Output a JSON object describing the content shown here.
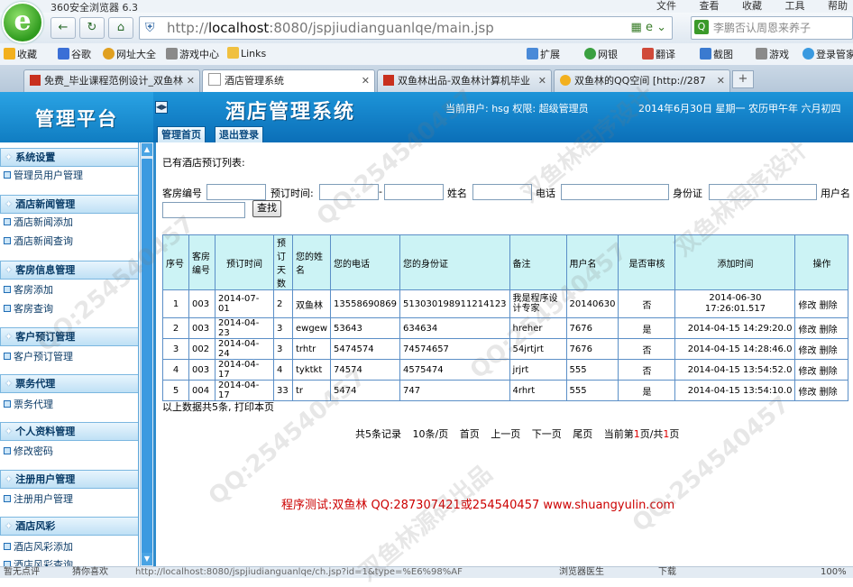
{
  "browser": {
    "title": "360安全浏览器 6.3",
    "menu": [
      "文件",
      "查看",
      "收藏",
      "工具",
      "帮助"
    ],
    "address_host": "localhost",
    "address_rest": ":8080/jspjiudianguanlqe/main.jsp",
    "address_prefix": "http://",
    "search_placeholder": "李鹏否认周恩来养子",
    "bookmarks": {
      "left": [
        "收藏",
        "谷歌",
        "网址大全",
        "游戏中心",
        "Links"
      ],
      "right": [
        "扩展",
        "网银",
        "翻译",
        "截图",
        "游戏",
        "登录管家"
      ]
    },
    "tabs": [
      "免费_毕业课程范例设计_双鱼林",
      "酒店管理系统",
      "双鱼林出品-双鱼林计算机毕业",
      "双鱼林的QQ空间 [http://287"
    ],
    "status": {
      "left": "暂无点评",
      "mid": "猜你喜欢",
      "url": "http://localhost:8080/jspjiudianguanlqe/ch.jsp?id=1&type=%E6%98%AF",
      "browser_doctor": "浏览器医生",
      "download": "下载",
      "zoom": "100%"
    }
  },
  "app": {
    "platform_title": "管理平台",
    "system_title": "酒店管理系统",
    "user_info": "当前用户: hsg 权限: 超级管理员",
    "date_info": "2014年6月30日 星期一 农历甲午年 六月初四",
    "header_tabs": [
      "管理首页",
      "退出登录"
    ]
  },
  "sidebar": [
    {
      "title": "系统设置",
      "items": [
        "管理员用户管理"
      ]
    },
    {
      "title": "酒店新闻管理",
      "items": [
        "酒店新闻添加",
        "酒店新闻查询"
      ]
    },
    {
      "title": "客房信息管理",
      "items": [
        "客房添加",
        "客房查询"
      ]
    },
    {
      "title": "客户预订管理",
      "items": [
        "客户预订管理"
      ]
    },
    {
      "title": "票务代理",
      "items": [
        "票务代理"
      ]
    },
    {
      "title": "个人资料管理",
      "items": [
        "修改密码"
      ]
    },
    {
      "title": "注册用户管理",
      "items": [
        "注册用户管理"
      ]
    },
    {
      "title": "酒店风彩",
      "items": [
        "酒店风彩添加",
        "酒店风彩查询"
      ]
    }
  ],
  "main": {
    "list_title": "已有酒店预订列表:",
    "filters": {
      "room_no": "客房编号",
      "order_time": "预订时间:",
      "range_sep": "-",
      "name": "姓名",
      "phone": "电话",
      "id_card": "身份证",
      "user_name": "用户名",
      "search_button": "查找"
    },
    "table": {
      "headers": [
        "序号",
        "客房编号",
        "预订时间",
        "预订天数",
        "您的姓名",
        "您的电话",
        "您的身份证",
        "备注",
        "用户名",
        "是否审核",
        "添加时间",
        "操作"
      ],
      "rows": [
        [
          "1",
          "003",
          "2014-07-01",
          "2",
          "双鱼林",
          "13558690869",
          "513030198911214123",
          "我是程序设计专家",
          "20140630",
          "否",
          "2014-06-30 17:26:01.517"
        ],
        [
          "2",
          "003",
          "2014-04-23",
          "3",
          "ewgew",
          "53643",
          "634634",
          "hreher",
          "7676",
          "是",
          "2014-04-15 14:29:20.0"
        ],
        [
          "3",
          "002",
          "2014-04-24",
          "3",
          "trhtr",
          "5474574",
          "74574657",
          "54jrtjrt",
          "7676",
          "否",
          "2014-04-15 14:28:46.0"
        ],
        [
          "4",
          "003",
          "2014-04-17",
          "4",
          "tyktkt",
          "74574",
          "4575474",
          "jrjrt",
          "555",
          "否",
          "2014-04-15 13:54:52.0"
        ],
        [
          "5",
          "004",
          "2014-04-17",
          "33",
          "tr",
          "5474",
          "747",
          "4rhrt",
          "555",
          "是",
          "2014-04-15 13:54:10.0"
        ]
      ],
      "edit_label": "修改",
      "delete_label": "删除"
    },
    "summary": "以上数据共5条, 打印本页",
    "pager": {
      "total": "共5条记录",
      "per_page": "10条/页",
      "first": "首页",
      "prev": "上一页",
      "next": "下一页",
      "last": "尾页",
      "current_prefix": "当前第",
      "current_page": "1",
      "current_mid": "页/共",
      "total_pages": "1",
      "current_suffix": "页"
    },
    "credit": "程序测试:双鱼林 QQ:287307421或254540457 www.shuangyulin.com"
  },
  "watermarks": [
    "QQ:254540457",
    "双鱼林程序设计",
    "双鱼林源码出品"
  ],
  "colors": {
    "header_blue": "#0b6fb8",
    "table_header": "#ccf3f5",
    "credit_red": "#cc0000"
  }
}
